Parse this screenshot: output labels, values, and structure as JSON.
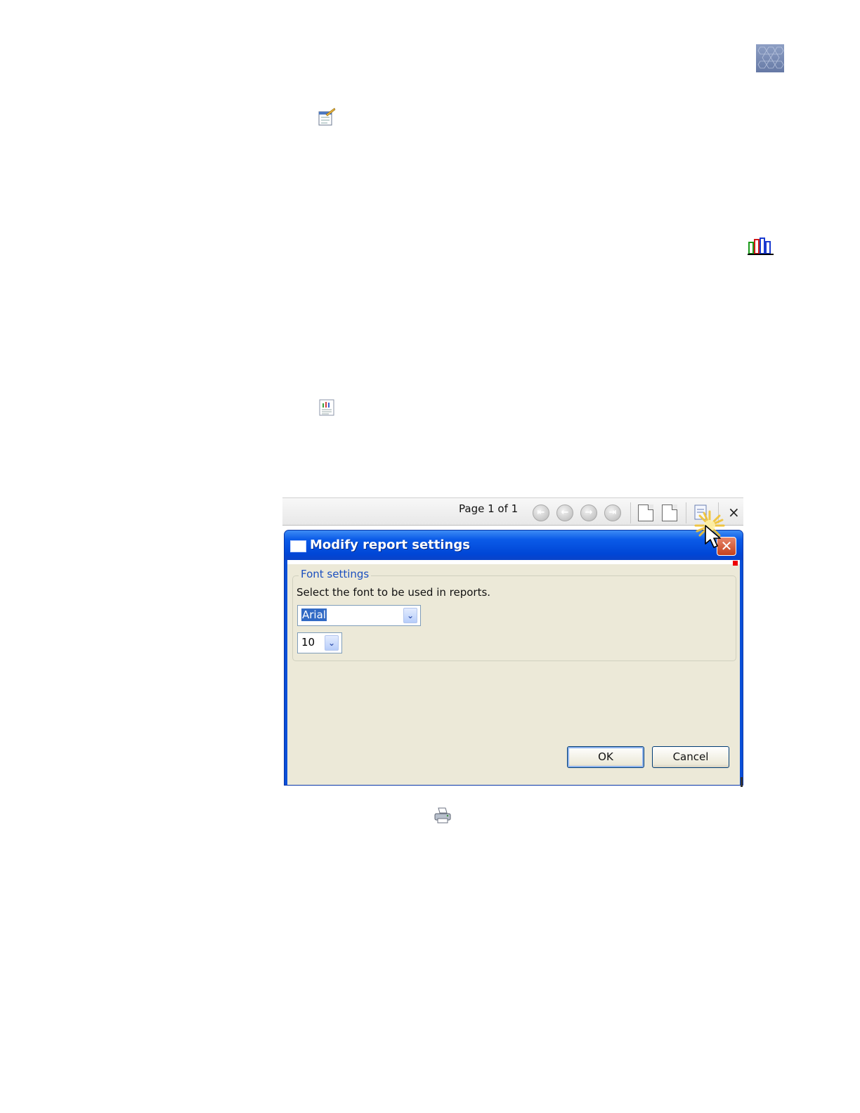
{
  "toolbar": {
    "page_indicator": "Page 1 of 1",
    "close_label": "×"
  },
  "dialog": {
    "title": "Modify report settings",
    "close_label": "✕",
    "font_group_label": "Font settings",
    "instructions": "Select the font to be used in reports.",
    "font_family_value": "Arial",
    "font_size_value": "10",
    "ok_label": "OK",
    "cancel_label": "Cancel"
  },
  "icons": {
    "logo": "hexagon-pattern-icon",
    "doc_top": "document-edit-icon",
    "chart": "bar-chart-icon",
    "doc_mid": "report-icon",
    "printer": "printer-icon"
  }
}
